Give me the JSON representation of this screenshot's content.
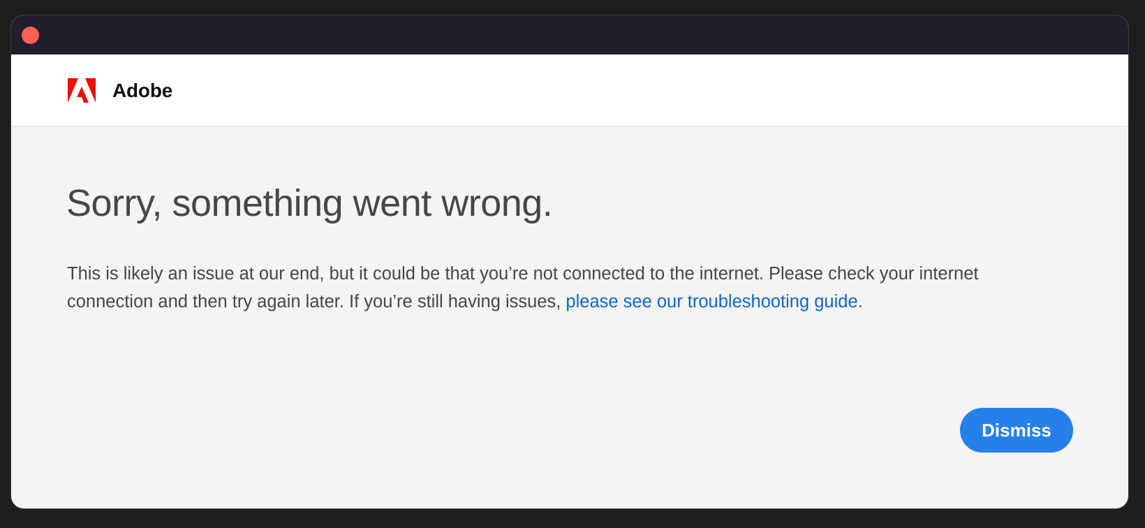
{
  "window": {
    "close_button": "close",
    "titlebar_color": "#221e2b"
  },
  "header": {
    "logo_icon": "adobe-logo-icon",
    "brand_name": "Adobe",
    "brand_color": "#eb1000"
  },
  "error": {
    "title": "Sorry, something went wrong.",
    "message_prefix": "This is likely an issue at our end, but it could be that you’re not connected to the internet. Please check your internet connection and then try again later. If you’re still having issues, ",
    "link_text": "please see our troubleshooting guide",
    "message_suffix": ".",
    "link_color": "#0d66d0"
  },
  "actions": {
    "dismiss_label": "Dismiss",
    "accent_color": "#2680eb"
  }
}
